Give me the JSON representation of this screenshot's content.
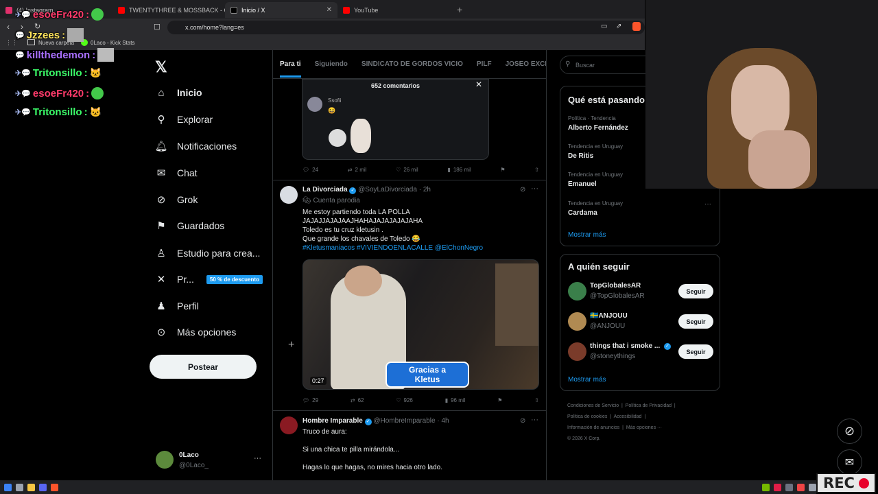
{
  "browser": {
    "tabs": [
      {
        "label": "(4) Instagram",
        "color": "#e1306c",
        "active": false
      },
      {
        "label": "TWENTYTHREE & MOSSBACK - C",
        "color": "#ff0000",
        "active": false
      },
      {
        "label": "Inicio / X",
        "color": "#ffffff",
        "active": true
      },
      {
        "label": "YouTube",
        "color": "#ff0000",
        "active": false
      }
    ],
    "url": "x.com/home?lang=es",
    "bookmarks": [
      "Nueva carpeta",
      "0Laco - Kick Stats"
    ]
  },
  "chat": [
    {
      "user": "esoeFr420",
      "color": "#ff3b6b",
      "emote": "green-blob"
    },
    {
      "user": "Jzzees",
      "color": "#ffe45c",
      "emote": "image"
    },
    {
      "user": "killthedemon",
      "color": "#a970ff",
      "emote": "image"
    },
    {
      "user": "Tritonsillo",
      "color": "#3cff6a",
      "emote": "cat"
    },
    {
      "user": "esoeFr420",
      "color": "#ff3b6b",
      "emote": "green-blob"
    },
    {
      "user": "Tritonsillo",
      "color": "#3cff6a",
      "emote": "cat"
    }
  ],
  "nav": {
    "items": [
      "Inicio",
      "Explorar",
      "Notificaciones",
      "Chat",
      "Grok",
      "Guardados",
      "Estudio para crea...",
      "Pr...",
      "Perfil",
      "Más opciones"
    ],
    "promo_badge": "50 % de descuento",
    "post_button": "Postear",
    "account": {
      "name": "0Laco",
      "handle": "@0Laco_"
    }
  },
  "timeline": {
    "tabs": [
      "Para ti",
      "Siguiendo",
      "SINDICATO DE GORDOS VICIO",
      "PILF",
      "JOSEO EXCLUSI"
    ],
    "post0": {
      "comments_header": "652 comentarios",
      "comment_user": "Ssofii",
      "stats": [
        "24",
        "2 mil",
        "26 mil",
        "186 mil"
      ]
    },
    "post1": {
      "name": "La Divorciada",
      "handle": "@SoyLaDivorciada",
      "time": "2h",
      "label": "Cuenta parodia",
      "lines": [
        "Me estoy partiendo toda LA POLLA",
        "JAJAJJAJAJAAJHAHAJAJAJAJAJAHA",
        "Toledo es tu cruz kletusin .",
        "Que grande los chavales de Toledo 😂"
      ],
      "hashtags": "#Kletusmaniacos #VIVIENDOENLACALLE @ElChonNegro",
      "video_time": "0:27",
      "video_banner": [
        "Gracias a",
        "Kletus"
      ],
      "stats": [
        "29",
        "62",
        "926",
        "96 mil"
      ]
    },
    "post2": {
      "name": "Hombre Imparable",
      "handle": "@HombreImparable",
      "time": "4h",
      "lines": [
        "Truco de aura:",
        "Si una chica te pilla mirándola...",
        "Hagas lo que hagas, no mires hacia otro lado."
      ]
    }
  },
  "right": {
    "search_placeholder": "Buscar",
    "trends_title": "Qué está pasando",
    "trends": [
      {
        "category": "Política · Tendencia",
        "name": "Alberto Fernández"
      },
      {
        "category": "Tendencia en Uruguay",
        "name": "De Ritis"
      },
      {
        "category": "Tendencia en Uruguay",
        "name": "Emanuel"
      },
      {
        "category": "Tendencia en Uruguay",
        "name": "Cardama"
      }
    ],
    "show_more": "Mostrar más",
    "follow_title": "A quién seguir",
    "follow": [
      {
        "name": "TopGlobalesAR",
        "handle": "@TopGlobalesAR",
        "button": "Seguir",
        "color": "#3a7f4a"
      },
      {
        "name": "🇸🇪ANJOUU",
        "handle": "@ANJOUU",
        "button": "Seguir",
        "color": "#b08a52"
      },
      {
        "name": "things that i smoke ...",
        "handle": "@stoneythings",
        "button": "Seguir",
        "color": "#7a3b2a"
      }
    ],
    "footer": [
      "Condiciones de Servicio",
      "Política de Privacidad",
      "Política de cookies",
      "Accesibilidad",
      "Información de anuncios",
      "Más opciones ···",
      "© 2026 X Corp."
    ]
  },
  "overlay": {
    "rec": "REC"
  }
}
